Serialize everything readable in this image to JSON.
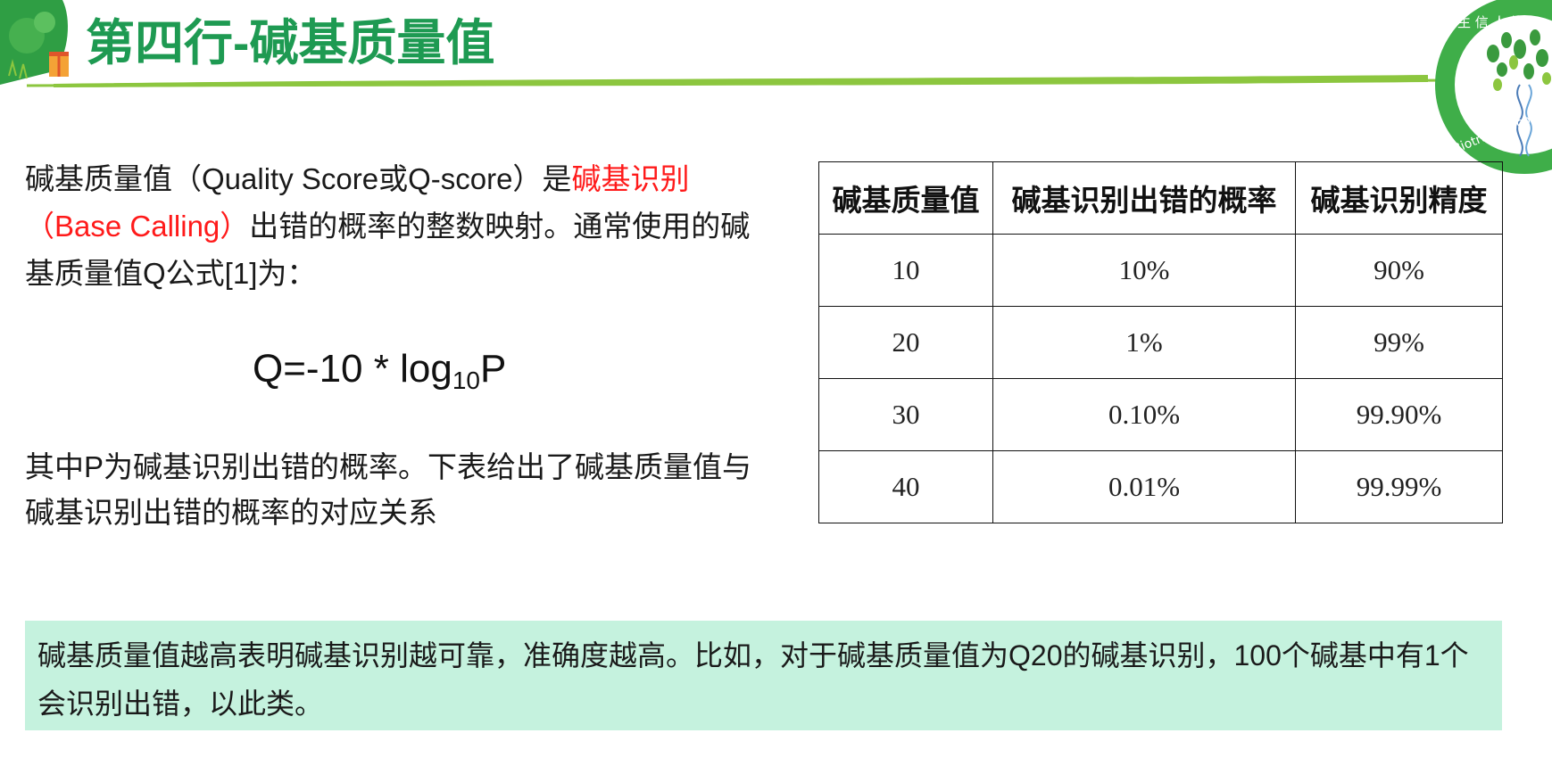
{
  "header": {
    "title": "第四行-碱基质量值",
    "accent_color": "#1e9a52",
    "line_color": "#8cc63f"
  },
  "logo": {
    "icon": "biotree-logo-icon",
    "ring_color": "#3fae49",
    "ring_text_top": "生 信 人 能",
    "ring_text_bottom": "Biotrainee.com"
  },
  "intro": {
    "part1": "碱基质量值（Quality Score或Q-score）是",
    "highlight": "碱基识别（Base Calling）",
    "part2": "出错的概率的整数映射。通常使用的碱基质量值Q公式[1]为："
  },
  "formula": {
    "lhs": "Q=-10 * log",
    "sub": "10",
    "rhs": "P"
  },
  "explanation": "其中P为碱基识别出错的概率。下表给出了碱基质量值与碱基识别出错的概率的对应关系",
  "table": {
    "headers": [
      "碱基质量值",
      "碱基识别出错的概率",
      "碱基识别精度"
    ],
    "rows": [
      [
        "10",
        "10%",
        "90%"
      ],
      [
        "20",
        "1%",
        "99%"
      ],
      [
        "30",
        "0.10%",
        "99.90%"
      ],
      [
        "40",
        "0.01%",
        "99.99%"
      ]
    ]
  },
  "note": {
    "text": "碱基质量值越高表明碱基识别越可靠，准确度越高。比如，对于碱基质量值为Q20的碱基识别，100个碱基中有1个会识别出错，以此类。",
    "background": "#c5f2de"
  }
}
